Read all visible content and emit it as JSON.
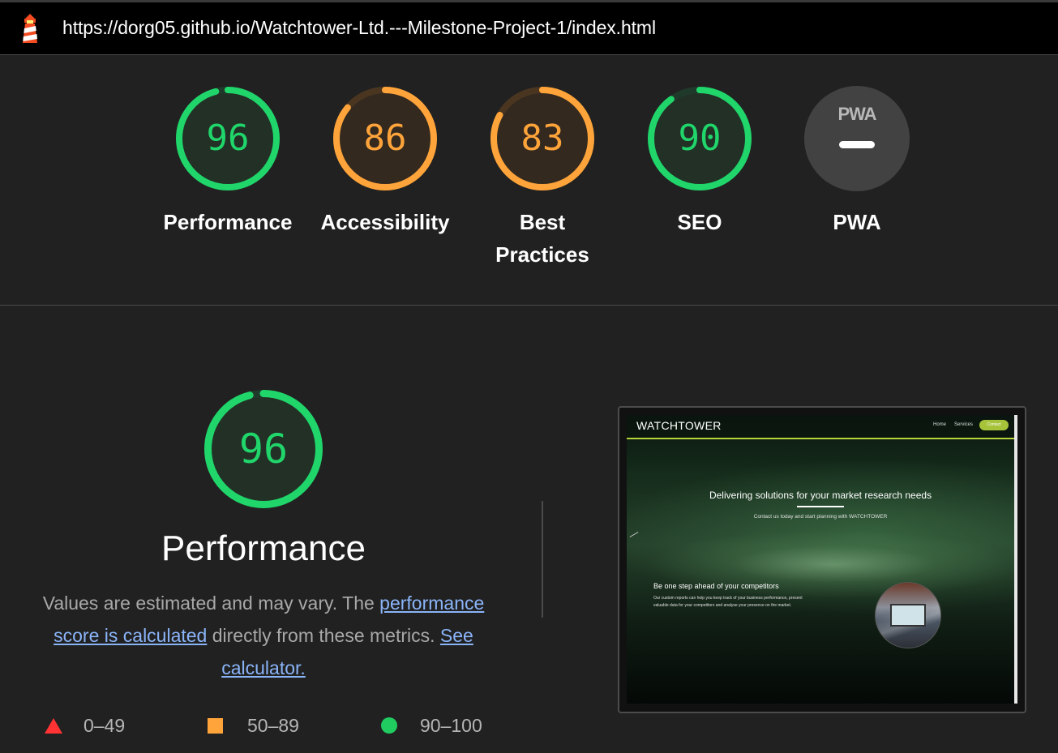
{
  "browser": {
    "url": "https://dorg05.github.io/Watchtower-Ltd.---Milestone-Project-1/index.html",
    "icon": "lighthouse-icon"
  },
  "categories": [
    {
      "label": "Performance",
      "score": "96",
      "fraction": 0.96,
      "color": "#20d66b",
      "track": "#1f3a2a",
      "fill": "#223026"
    },
    {
      "label": "Accessibility",
      "score": "86",
      "fraction": 0.86,
      "color": "#ffa43a",
      "track": "#4a3520",
      "fill": "#33291f"
    },
    {
      "label": "Best",
      "label2": "Practices",
      "score": "83",
      "fraction": 0.83,
      "color": "#ffa43a",
      "track": "#4a3520",
      "fill": "#33291f"
    },
    {
      "label": "SEO",
      "score": "90",
      "fraction": 0.9,
      "color": "#20d66b",
      "track": "#1f3a2a",
      "fill": "#223026"
    },
    {
      "label": "PWA",
      "badge": "PWA"
    }
  ],
  "performance": {
    "score": "96",
    "fraction": 0.96,
    "title": "Performance",
    "desc_start": "Values are estimated and may vary. The ",
    "link1": "performance score is calculated",
    "desc_mid": " directly from these metrics. ",
    "link2": "See calculator."
  },
  "legend": [
    {
      "icon": "triangle-red-icon",
      "range": "0–49",
      "color": "#ff3333"
    },
    {
      "icon": "square-orange-icon",
      "range": "50–89",
      "color": "#ffa43a"
    },
    {
      "icon": "circle-green-icon",
      "range": "90–100",
      "color": "#20cc60"
    }
  ],
  "screenshot": {
    "brand": "WATCHTOWER",
    "nav": [
      "Home",
      "Services",
      "Contact"
    ],
    "headline": "Delivering solutions for your market research needs",
    "subline": "Contact us today and start planning with WATCHTOWER",
    "section_title": "Be one step ahead of your competitors",
    "section_text": "Our custom reports can help you keep track of your business performance, present valuable data for your competitors and analyse your presence on the market."
  }
}
